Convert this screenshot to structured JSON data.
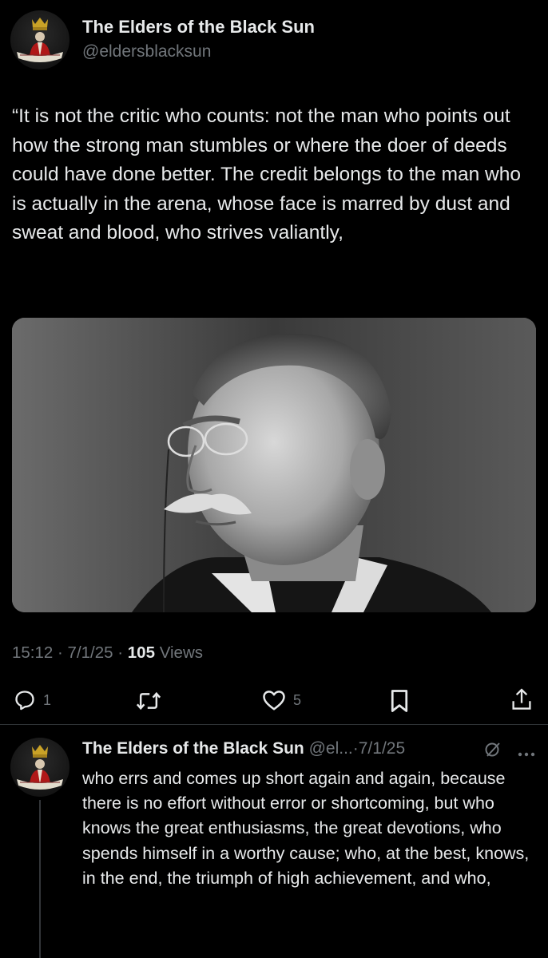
{
  "tweet": {
    "author_name": "The Elders of the Black Sun",
    "author_handle": "@eldersblacksun",
    "text": "“It is not the critic who counts: not the man who points out how the strong man stumbles or where the doer of deeds could have done better. The credit belongs to the man who is actually in the arena, whose face is marred by dust and sweat and blood, who strives valiantly,",
    "time": "15:12",
    "date": "7/1/25",
    "separator": "·",
    "views_count": "105",
    "views_label": "Views",
    "actions": {
      "reply_icon": "reply-icon",
      "reply_count": "1",
      "retweet_icon": "retweet-icon",
      "like_icon": "heart-icon",
      "like_count": "5",
      "bookmark_icon": "bookmark-icon",
      "share_icon": "share-icon"
    }
  },
  "reply": {
    "author_name": "The Elders of the Black Sun",
    "author_handle": "@el...",
    "separator": "·",
    "date": "7/1/25",
    "text": "who errs and comes up short again and again, because there is no effort without error or shortcoming, but who knows the great enthusiasms, the great devotions, who spends himself in a worthy cause; who, at the best, knows, in the end, the triumph of high achievement, and who,",
    "icons": [
      "grok-icon",
      "more-icon"
    ]
  },
  "colors": {
    "background": "#000000",
    "text_primary": "#e7e9ea",
    "text_secondary": "#71767b",
    "divider": "#2f3336"
  }
}
